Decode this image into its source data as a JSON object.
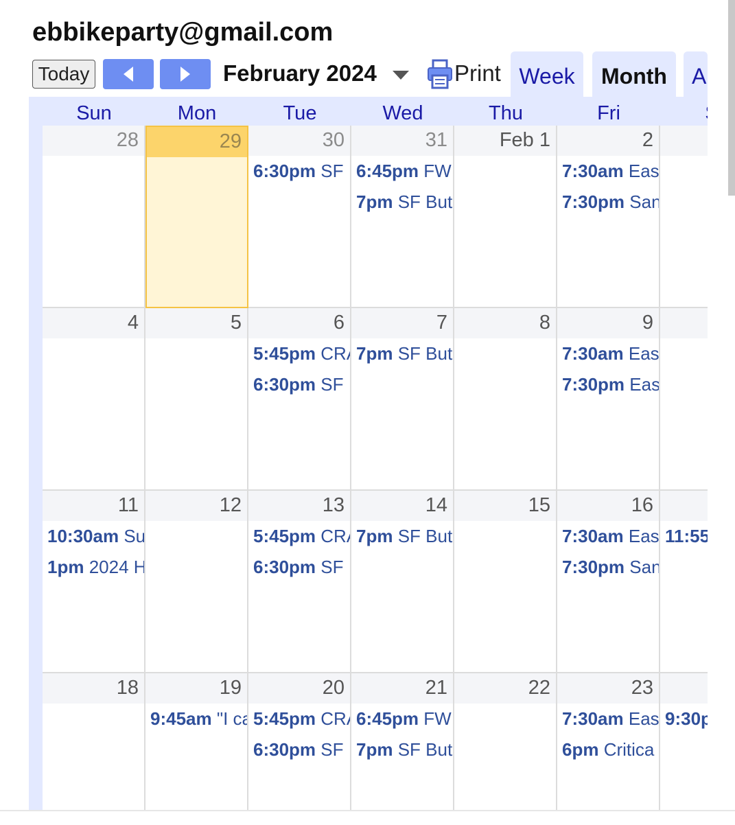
{
  "header": {
    "title": "ebbikeparty@gmail.com",
    "today_label": "Today",
    "month_label": "February 2024",
    "print_label": "Print",
    "tabs": {
      "week": "Week",
      "month": "Month",
      "agenda": "A"
    },
    "active_tab": "Month"
  },
  "weekdays": [
    "Sun",
    "Mon",
    "Tue",
    "Wed",
    "Thu",
    "Fri",
    "S"
  ],
  "weeks": [
    {
      "days": [
        {
          "date": "28",
          "other_month": true,
          "events": []
        },
        {
          "date": "29",
          "other_month": true,
          "today": true,
          "events": []
        },
        {
          "date": "30",
          "other_month": true,
          "events": [
            {
              "time": "6:30pm",
              "title": "SF I"
            }
          ]
        },
        {
          "date": "31",
          "other_month": true,
          "events": [
            {
              "time": "6:45pm",
              "title": "FWI"
            },
            {
              "time": "7pm",
              "title": "SF But"
            }
          ]
        },
        {
          "date": "Feb 1",
          "events": []
        },
        {
          "date": "2",
          "events": [
            {
              "time": "7:30am",
              "title": "Eas"
            },
            {
              "time": "7:30pm",
              "title": "San"
            }
          ]
        },
        {
          "date": "",
          "events": []
        }
      ]
    },
    {
      "days": [
        {
          "date": "4",
          "events": []
        },
        {
          "date": "5",
          "events": []
        },
        {
          "date": "6",
          "events": [
            {
              "time": "5:45pm",
              "title": "CRA"
            },
            {
              "time": "6:30pm",
              "title": "SF I"
            }
          ]
        },
        {
          "date": "7",
          "events": [
            {
              "time": "7pm",
              "title": "SF But"
            }
          ]
        },
        {
          "date": "8",
          "events": []
        },
        {
          "date": "9",
          "events": [
            {
              "time": "7:30am",
              "title": "Eas"
            },
            {
              "time": "7:30pm",
              "title": "Eas"
            }
          ]
        },
        {
          "date": "",
          "events": []
        }
      ]
    },
    {
      "days": [
        {
          "date": "11",
          "events": [
            {
              "time": "10:30am",
              "title": "Su"
            },
            {
              "time": "1pm",
              "title": "2024 H"
            }
          ]
        },
        {
          "date": "12",
          "events": []
        },
        {
          "date": "13",
          "events": [
            {
              "time": "5:45pm",
              "title": "CRA"
            },
            {
              "time": "6:30pm",
              "title": "SF I"
            }
          ]
        },
        {
          "date": "14",
          "events": [
            {
              "time": "7pm",
              "title": "SF But"
            }
          ]
        },
        {
          "date": "15",
          "events": []
        },
        {
          "date": "16",
          "events": [
            {
              "time": "7:30am",
              "title": "Eas"
            },
            {
              "time": "7:30pm",
              "title": "San"
            }
          ]
        },
        {
          "date": "",
          "events": [
            {
              "time": "11:55",
              "title": ""
            }
          ]
        }
      ]
    },
    {
      "days": [
        {
          "date": "18",
          "events": []
        },
        {
          "date": "19",
          "events": [
            {
              "time": "9:45am",
              "title": "\"I ca"
            }
          ]
        },
        {
          "date": "20",
          "events": [
            {
              "time": "5:45pm",
              "title": "CRA"
            },
            {
              "time": "6:30pm",
              "title": "SF I"
            }
          ]
        },
        {
          "date": "21",
          "events": [
            {
              "time": "6:45pm",
              "title": "FWI"
            },
            {
              "time": "7pm",
              "title": "SF But"
            }
          ]
        },
        {
          "date": "22",
          "events": []
        },
        {
          "date": "23",
          "events": [
            {
              "time": "7:30am",
              "title": "Eas"
            },
            {
              "time": "6pm",
              "title": "Critica"
            }
          ]
        },
        {
          "date": "",
          "events": [
            {
              "time": "9:30p",
              "title": ""
            }
          ]
        }
      ]
    }
  ],
  "colors": {
    "accent": "#6e8ef2",
    "grid_background": "#e3e9ff",
    "weekday_text": "#1a1aa6",
    "event_text": "#2f4f9a",
    "today_highlight": "#fcd46b"
  }
}
